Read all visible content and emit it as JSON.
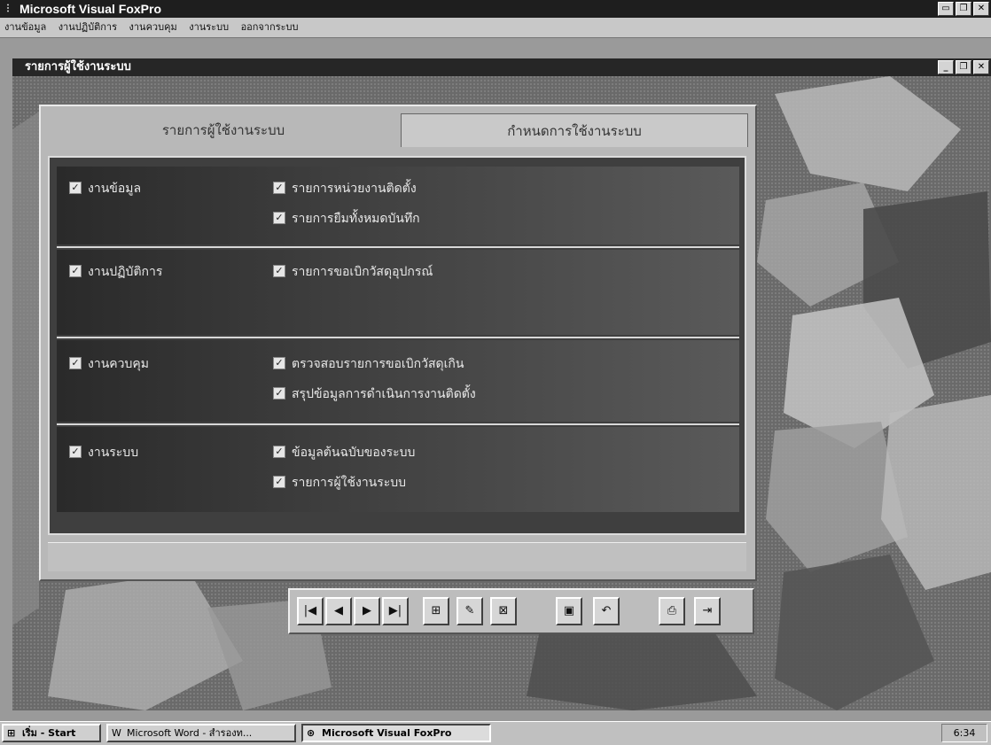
{
  "app": {
    "title": "Microsoft Visual FoxPro",
    "window_buttons": [
      "▭",
      "❐",
      "✕"
    ]
  },
  "menu": [
    "งานข้อมูล",
    "งานปฏิบัติการ",
    "งานควบคุม",
    "งานระบบ",
    "ออกจากระบบ"
  ],
  "child_window": {
    "title": "รายการผู้ใช้งานระบบ",
    "window_buttons": [
      "_",
      "❐",
      "✕"
    ]
  },
  "tabs": [
    {
      "label": "รายการผู้ใช้งานระบบ",
      "active": false
    },
    {
      "label": "กำหนดการใช้งานระบบ",
      "active": true
    }
  ],
  "sections": [
    {
      "label": "งานข้อมูล",
      "checked": true,
      "items": [
        "รายการหน่วยงานติดตั้ง",
        "รายการยืมทั้งหมดบันทึก"
      ]
    },
    {
      "label": "งานปฏิบัติการ",
      "checked": true,
      "items": [
        "รายการขอเบิกวัสดุอุปกรณ์"
      ]
    },
    {
      "label": "งานควบคุม",
      "checked": true,
      "items": [
        "ตรวจสอบรายการขอเบิกวัสดุเกิน",
        "สรุปข้อมูลการดำเนินการงานติดตั้ง"
      ]
    },
    {
      "label": "งานระบบ",
      "checked": true,
      "items": [
        "ข้อมูลต้นฉบับของระบบ",
        "รายการผู้ใช้งานระบบ"
      ]
    }
  ],
  "toolbar": [
    {
      "icon": "first-record-icon",
      "glyph": "|◀"
    },
    {
      "icon": "prev-record-icon",
      "glyph": "◀"
    },
    {
      "icon": "next-record-icon",
      "glyph": "▶"
    },
    {
      "icon": "last-record-icon",
      "glyph": "▶|"
    },
    {
      "icon": "add-record-icon",
      "glyph": "⊞"
    },
    {
      "icon": "edit-record-icon",
      "glyph": "✎"
    },
    {
      "icon": "delete-record-icon",
      "glyph": "⊠"
    },
    {
      "icon": "save-icon",
      "glyph": "▣"
    },
    {
      "icon": "undo-icon",
      "glyph": "↶"
    },
    {
      "icon": "print-icon",
      "glyph": "⎙"
    },
    {
      "icon": "exit-icon",
      "glyph": "⇥"
    }
  ],
  "taskbar": {
    "start": "เริ่ม - Start",
    "tasks": [
      {
        "label": "Microsoft Word - สำรองท...",
        "pressed": false
      },
      {
        "label": "Microsoft Visual FoxPro",
        "pressed": true
      }
    ],
    "clock": "6:34"
  }
}
